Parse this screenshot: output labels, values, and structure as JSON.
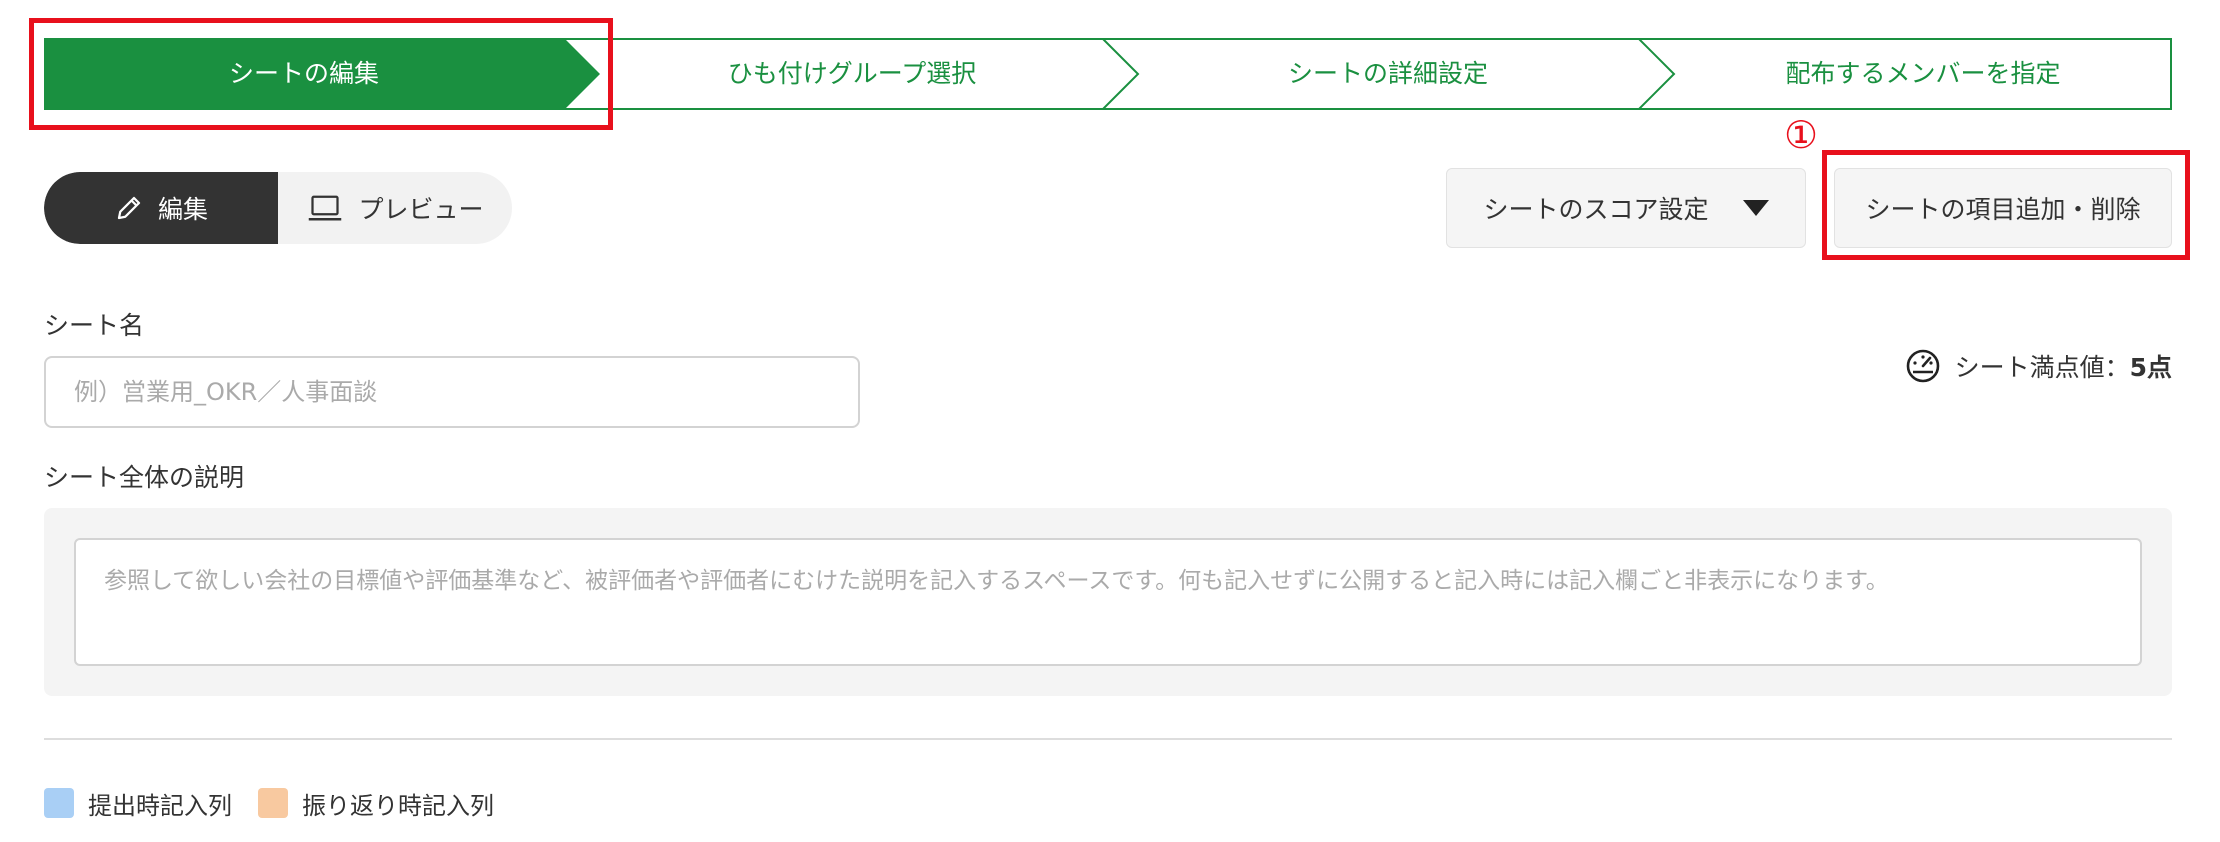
{
  "stepper": {
    "steps": [
      {
        "label": "シートの編集"
      },
      {
        "label": "ひも付けグループ選択"
      },
      {
        "label": "シートの詳細設定"
      },
      {
        "label": "配布するメンバーを指定"
      }
    ]
  },
  "annotation": {
    "number": "①"
  },
  "mode": {
    "edit_label": "編集",
    "preview_label": "プレビュー"
  },
  "actions": {
    "score_setting_label": "シートのスコア設定",
    "item_edit_label": "シートの項目追加・削除"
  },
  "form": {
    "sheet_name_label": "シート名",
    "sheet_name_placeholder": "例）営業用_OKR／人事面談",
    "description_label": "シート全体の説明",
    "description_placeholder": "参照して欲しい会社の目標値や評価基準など、被評価者や評価者にむけた説明を記入するスペースです。何も記入せずに公開すると記入時には記入欄ごと非表示になります。"
  },
  "score_info": {
    "label": "シート満点値：",
    "value": "5点"
  },
  "legend": {
    "items": [
      {
        "label": "提出時記入列",
        "color": "#a9cff5"
      },
      {
        "label": "振り返り時記入列",
        "color": "#f8c9a0"
      }
    ]
  },
  "colors": {
    "accent_green": "#1a9040",
    "annotation_red": "#e8101c"
  }
}
